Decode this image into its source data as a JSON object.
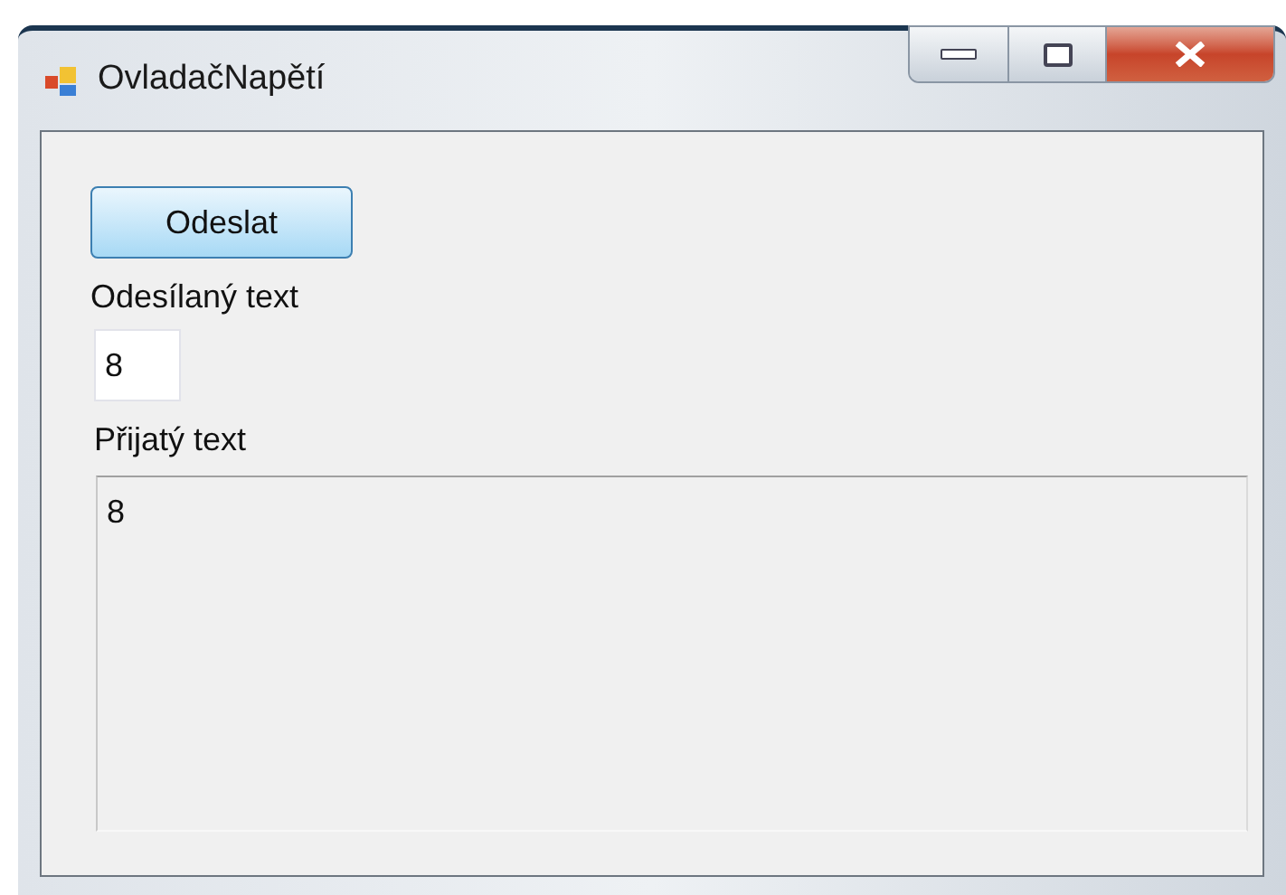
{
  "window": {
    "title": "OvladačNapětí"
  },
  "send_button": {
    "label": "Odeslat"
  },
  "sent_label": "Odesílaný text",
  "sent_field": {
    "value": "8"
  },
  "received_label": "Přijatý text",
  "received_field": {
    "value": "8",
    "read_only": true
  }
}
